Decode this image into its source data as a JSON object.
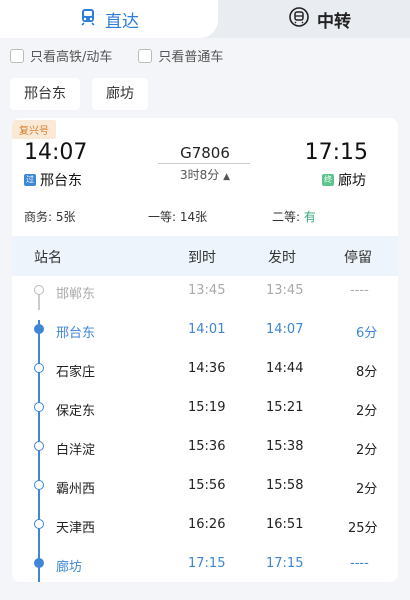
{
  "tabs": {
    "direct": "直达",
    "transfer": "中转"
  },
  "filters": {
    "high_speed_only": "只看高铁/动车",
    "regular_only": "只看普通车"
  },
  "stations_chips": {
    "from": "邢台东",
    "to": "廊坊"
  },
  "train": {
    "badge": "复兴号",
    "number": "G7806",
    "duration": "3时8分",
    "depart_time": "14:07",
    "arrive_time": "17:15",
    "from_station": "邢台东",
    "to_station": "廊坊",
    "from_tag": "过",
    "to_tag": "终",
    "from_tag_color": "#3e86d6",
    "to_tag_color": "#5cc48b"
  },
  "seats": {
    "business": "商务: 5张",
    "first": "一等: 14张",
    "second_label": "二等:",
    "second_value": "有"
  },
  "table": {
    "headers": {
      "station": "站名",
      "arrive": "到时",
      "depart": "发时",
      "stop": "停留"
    },
    "rows": [
      {
        "station": "邯郸东",
        "arrive": "13:45",
        "depart": "13:45",
        "stop": "----"
      },
      {
        "station": "邢台东",
        "arrive": "14:01",
        "depart": "14:07",
        "stop": "6分"
      },
      {
        "station": "石家庄",
        "arrive": "14:36",
        "depart": "14:44",
        "stop": "8分"
      },
      {
        "station": "保定东",
        "arrive": "15:19",
        "depart": "15:21",
        "stop": "2分"
      },
      {
        "station": "白洋淀",
        "arrive": "15:36",
        "depart": "15:38",
        "stop": "2分"
      },
      {
        "station": "霸州西",
        "arrive": "15:56",
        "depart": "15:58",
        "stop": "2分"
      },
      {
        "station": "天津西",
        "arrive": "16:26",
        "depart": "16:51",
        "stop": "25分"
      },
      {
        "station": "廊坊",
        "arrive": "17:15",
        "depart": "17:15",
        "stop": "----"
      }
    ]
  },
  "colors": {
    "accent": "#2f7ddb",
    "available": "#3aa57a",
    "badge_bg": "#fbe9d7",
    "badge_text": "#d47b2a"
  }
}
